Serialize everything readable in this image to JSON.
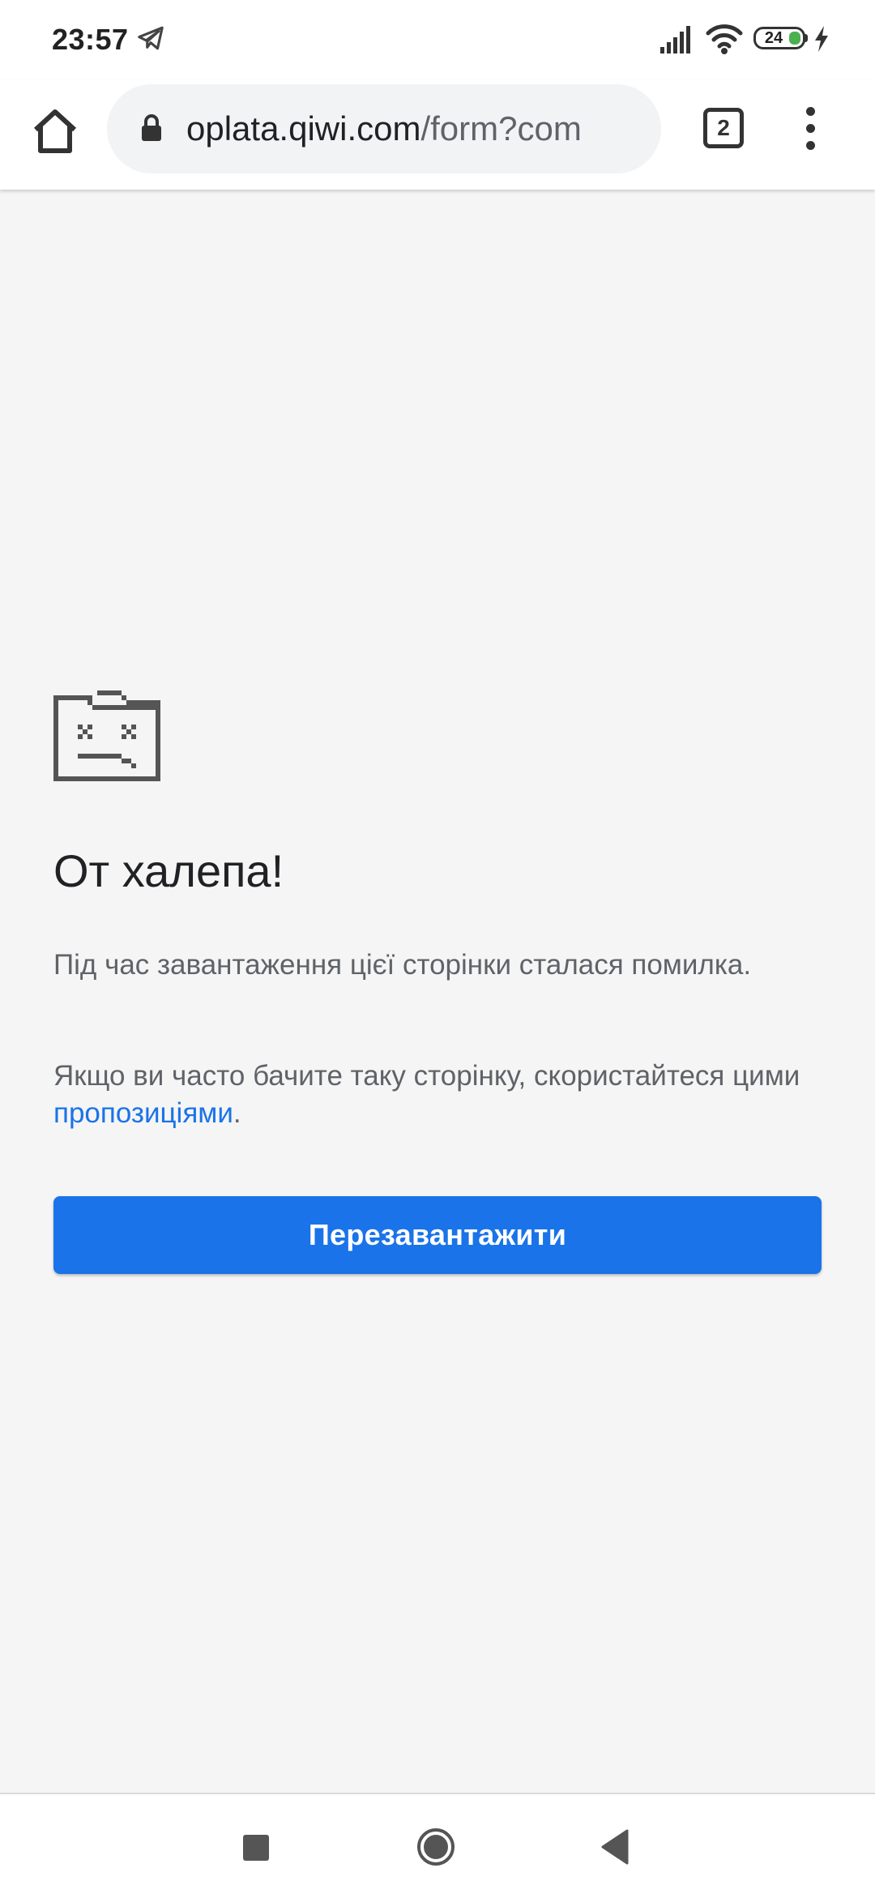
{
  "status_bar": {
    "time": "23:57",
    "battery_level": "24",
    "icons": [
      "telegram-icon",
      "signal-icon",
      "wifi-icon",
      "battery-icon",
      "charging-icon"
    ]
  },
  "toolbar": {
    "url_host": "oplata.qiwi.com",
    "url_path": "/form?com",
    "tab_count": "2",
    "icons": [
      "home-icon",
      "lock-icon",
      "tab-switcher-icon",
      "more-vert-icon"
    ]
  },
  "error_page": {
    "icon": "sad-tab-icon",
    "title": "От халепа!",
    "message": "Під час завантаження цієї сторінки сталася помилка.",
    "suggestion_prefix": "Якщо ви часто бачите таку сторінку, скористайтеся цими ",
    "suggestion_link": "пропозиціями",
    "suggestion_suffix": ".",
    "reload_label": "Перезавантажити"
  },
  "nav_bar": {
    "icons": [
      "recents-icon",
      "home-icon",
      "back-icon"
    ]
  },
  "colors": {
    "accent": "#1a73e8",
    "page_background": "#f5f5f5",
    "omnibox_background": "#f1f3f4",
    "text_primary": "#202124",
    "text_secondary": "#5f6368",
    "battery_green": "#4caf50"
  }
}
